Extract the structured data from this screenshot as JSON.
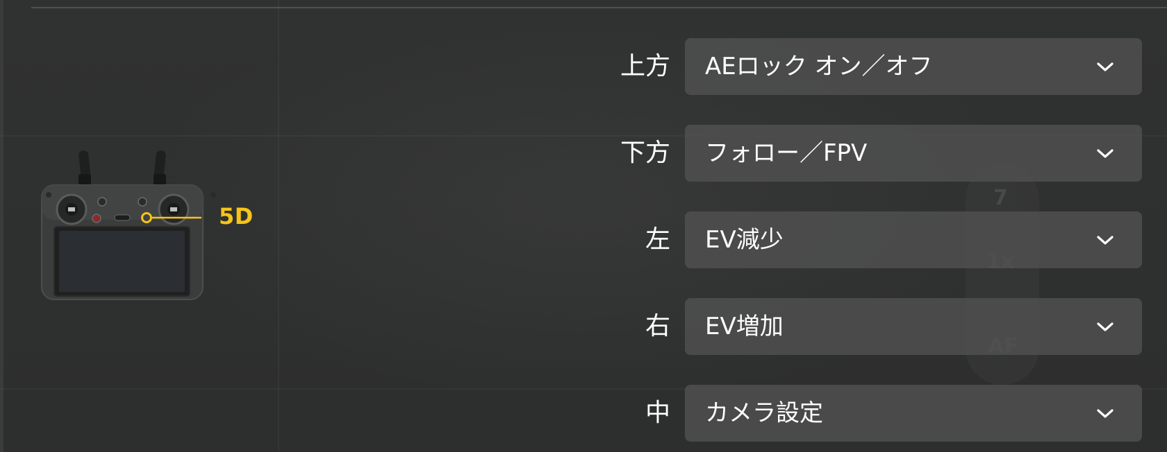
{
  "controller": {
    "callout_label": "5D",
    "callout_color": "#f5c518"
  },
  "background_ghost": {
    "top_text": "7",
    "zoom_text": "1x",
    "focus_text": "AF"
  },
  "rows": [
    {
      "label": "上方",
      "value": "AEロック オン／オフ"
    },
    {
      "label": "下方",
      "value": "フォロー／FPV"
    },
    {
      "label": "左",
      "value": "EV減少"
    },
    {
      "label": "右",
      "value": "EV増加"
    },
    {
      "label": "中",
      "value": "カメラ設定"
    }
  ],
  "icons": {
    "dropdown": "chevron-down-icon"
  },
  "colors": {
    "background": "#2e2f2f",
    "select_background": "#505150",
    "text": "#ffffff",
    "accent": "#f5c518"
  }
}
